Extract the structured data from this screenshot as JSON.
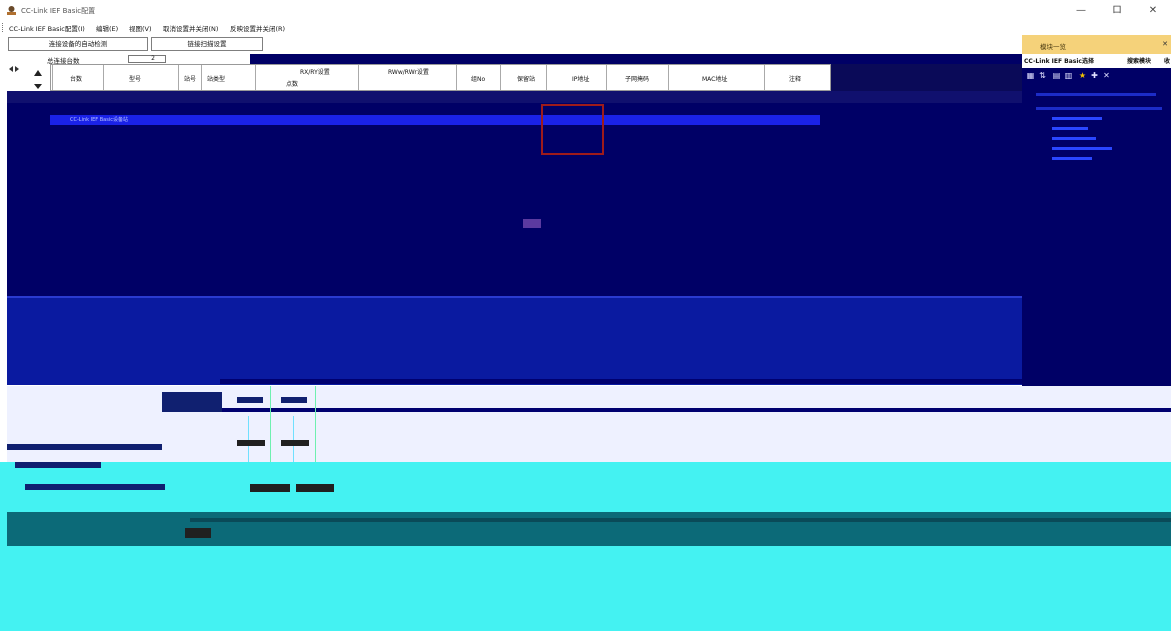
{
  "window": {
    "title": "CC-Link IEF Basic配置",
    "minimize_symbol": "—",
    "restore_symbol": "ロ",
    "close_symbol": "✕"
  },
  "menu": {
    "items": [
      "CC-Link IEF Basic配置(I)",
      "编辑(E)",
      "视图(V)",
      "取消设置并关闭(N)",
      "反映设置并关闭(R)"
    ]
  },
  "toolbar": {
    "auto_detect_label": "连接设备的自动检测",
    "link_scan_label": "链接扫描设置"
  },
  "summary": {
    "total_label": "总连接台数",
    "total_value": "2"
  },
  "grid": {
    "headers": {
      "count": "台数",
      "model": "型号",
      "station_no": "站号",
      "station_type": "站类型",
      "rx_ry": "RX/RY设置",
      "rwr_rww": "RWw/RWr设置",
      "group": "组No",
      "reserved": "保留站",
      "ip": "IP地址",
      "subnet": "子网掩码",
      "mac": "MAC地址",
      "comment": "注释",
      "points_sub": "点数"
    },
    "row_text": "CC-Link IEF Basic设备站"
  },
  "right_panel": {
    "title": "模块一览",
    "close_symbol": "✕",
    "tabs": [
      "CC-Link IEF Basic选择",
      "搜索模块",
      "收"
    ]
  },
  "colors": {
    "navy": "#000066",
    "cyan": "#44f2f2",
    "teal": "#0c6a78",
    "panel_gold": "#f5d27a",
    "highlight_blue": "#1a22e8",
    "red_outline": "#9e1b1b"
  }
}
